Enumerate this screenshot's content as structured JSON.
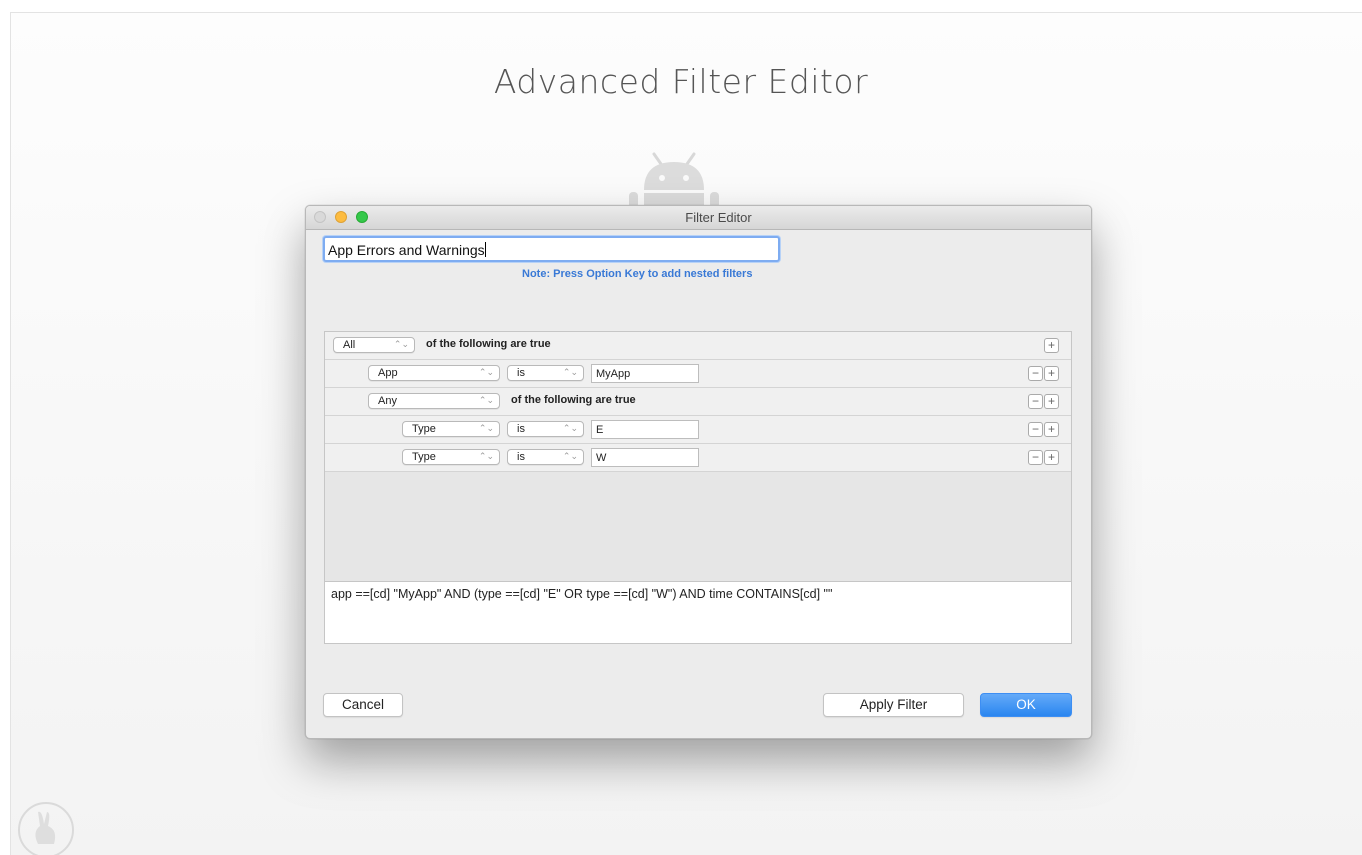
{
  "page": {
    "heading": "Advanced Filter Editor"
  },
  "window": {
    "title": "Filter Editor",
    "name_value": "App Errors and Warnings",
    "note": "Note: Press Option Key to add nested filters"
  },
  "rules": {
    "root": {
      "quantifier": "All",
      "text": "of the following are true"
    },
    "app_rule": {
      "field": "App",
      "operator": "is",
      "value": "MyApp"
    },
    "nested": {
      "quantifier": "Any",
      "text": "of the following are true"
    },
    "type_rule_1": {
      "field": "Type",
      "operator": "is",
      "value": "E"
    },
    "type_rule_2": {
      "field": "Type",
      "operator": "is",
      "value": "W"
    },
    "add_symbol": "+",
    "remove_symbol": "−",
    "popup_arrow": "⌃⌄"
  },
  "predicate": "app ==[cd] \"MyApp\" AND (type ==[cd] \"E\" OR type ==[cd] \"W\") AND time CONTAINS[cd] \"\"",
  "buttons": {
    "cancel": "Cancel",
    "apply": "Apply Filter",
    "ok": "OK"
  },
  "colors": {
    "accent": "#2a86f0",
    "note": "#3979d6",
    "close": "#d9d9d9",
    "minimize": "#fdbc40",
    "maximize": "#34c84a"
  },
  "icons": {
    "android": "android-robot-icon",
    "app_logo": "rabbit-logo-icon"
  }
}
